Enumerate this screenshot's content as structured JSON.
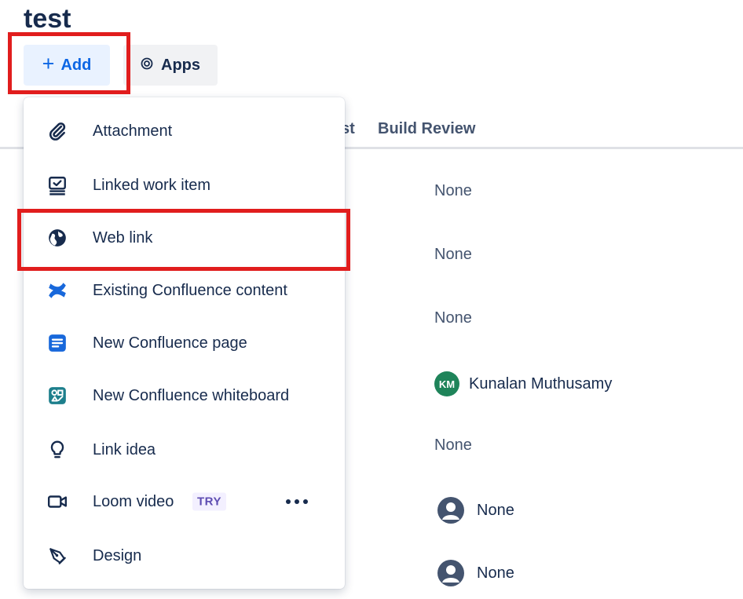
{
  "issue": {
    "title": "test"
  },
  "toolbar": {
    "add_label": "Add",
    "apps_label": "Apps"
  },
  "table": {
    "headers": [
      "st",
      "Build Review"
    ],
    "rows": [
      {
        "value": "None",
        "avatar": ""
      },
      {
        "value": "None",
        "avatar": ""
      },
      {
        "value": "None",
        "avatar": ""
      },
      {
        "value": "Kunalan Muthusamy",
        "avatar": "KM"
      },
      {
        "value": "None",
        "avatar": ""
      },
      {
        "value": "None",
        "avatar": "person-icon"
      },
      {
        "value": "None",
        "avatar": "person-icon"
      }
    ]
  },
  "add_menu": {
    "items": [
      {
        "label": "Attachment",
        "icon": "paperclip-icon"
      },
      {
        "label": "Linked work item",
        "icon": "linked-work-item-icon"
      },
      {
        "label": "Web link",
        "icon": "globe-icon"
      },
      {
        "label": "Existing Confluence content",
        "icon": "confluence-icon"
      },
      {
        "label": "New Confluence page",
        "icon": "confluence-page-icon"
      },
      {
        "label": "New Confluence whiteboard",
        "icon": "confluence-whiteboard-icon"
      },
      {
        "label": "Link idea",
        "icon": "lightbulb-icon"
      },
      {
        "label": "Loom video",
        "icon": "video-camera-icon",
        "badge": "TRY"
      },
      {
        "label": "Design",
        "icon": "design-pen-icon"
      }
    ]
  },
  "colors": {
    "accent": "#0c66e4",
    "highlight": "#e11d1d",
    "avatar_green": "#1f845a",
    "confluence_blue": "#1868db"
  }
}
